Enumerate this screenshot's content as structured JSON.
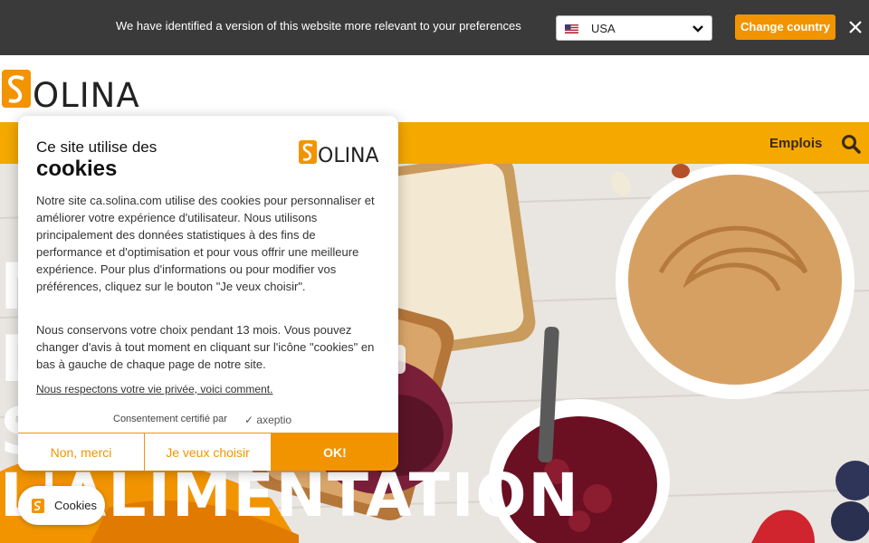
{
  "topbar": {
    "message": "We have identified a version of this website more relevant to your preferences",
    "country_value": "USA",
    "change_label": "Change country"
  },
  "header": {
    "logo_text": "SOLINA"
  },
  "nav": {
    "emplois_label": "Emplois"
  },
  "hero": {
    "lines": [
      "N",
      "D",
      "S",
      "L'ALIMENTATION"
    ]
  },
  "cookie": {
    "title_small": "Ce site utilise des",
    "title_big": "cookies",
    "logo_text": "SOLINA",
    "paragraph1": "Notre site ca.solina.com utilise des cookies pour personnaliser et améliorer votre expérience d'utilisateur. Nous utilisons principalement des données statistiques à des fins de performance et d'optimisation et pour vous offrir une meilleure expérience. Pour plus d'informations ou pour modifier vos préférences, cliquez sur le bouton \"Je veux choisir\".",
    "paragraph2": "Nous conservons votre choix pendant 13 mois. Vous pouvez changer d'avis à tout moment en cliquant sur l'icône \"cookies\" en bas à gauche de chaque page de notre site.",
    "privacy_link": "Nous respectons votre vie privée, voici comment.",
    "certified": "Consentement certifié par",
    "axeptio": "axeptio",
    "btn_no": "Non, merci",
    "btn_choose": "Je veux choisir",
    "btn_ok": "OK!"
  },
  "cookie_pill": {
    "label": "Cookies"
  },
  "colors": {
    "accent": "#f29400",
    "nav_bg": "#f5a800",
    "topbar_bg": "#3a3a3a"
  },
  "icons": [
    "us-flag-icon",
    "chevron-down-icon",
    "close-icon",
    "search-icon",
    "cookie-icon"
  ]
}
